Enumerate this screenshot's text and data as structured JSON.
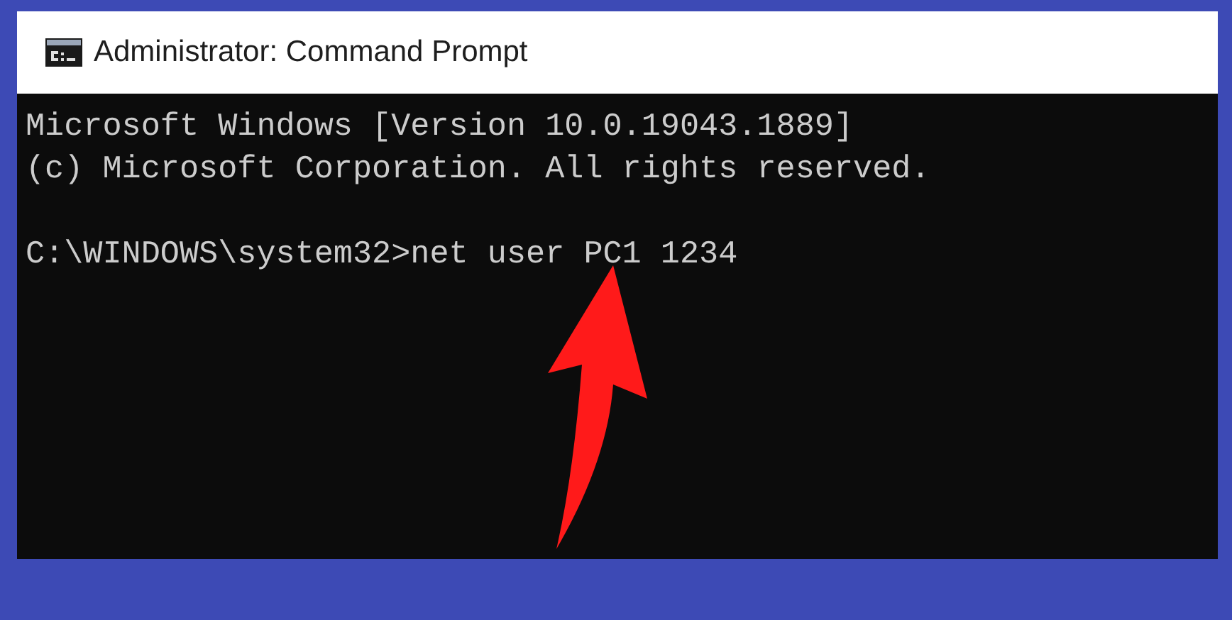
{
  "window": {
    "title": "Administrator: Command Prompt"
  },
  "console": {
    "output": [
      "Microsoft Windows [Version 10.0.19043.1889]",
      "(c) Microsoft Corporation. All rights reserved."
    ],
    "prompt": "C:\\WINDOWS\\system32>net user PC1 1234"
  }
}
